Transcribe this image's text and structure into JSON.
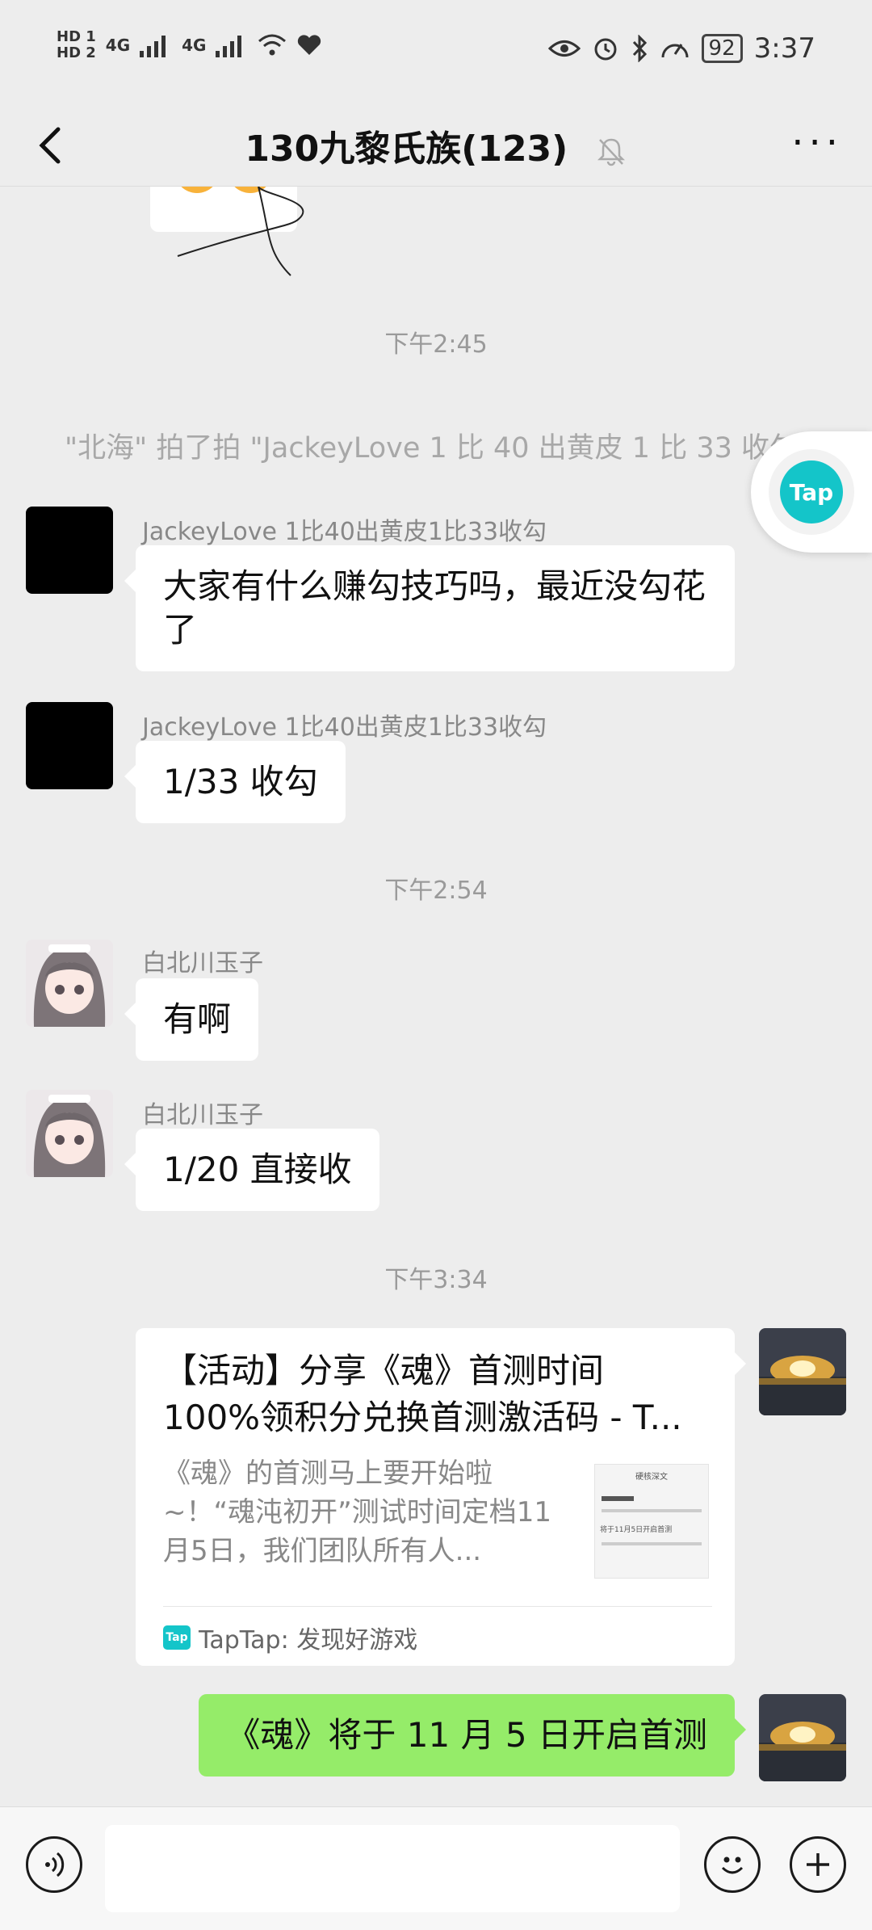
{
  "status_bar": {
    "time": "3:37",
    "battery": "92",
    "network_1": "4G",
    "network_2": "4G",
    "hd_1": "HD 1",
    "hd_2": "HD 2"
  },
  "header": {
    "title": "130九黎氏族(123)",
    "more": "···"
  },
  "messages": {
    "time_1": "下午2:45",
    "pat_text": "\"北海\" 拍了拍 \"JackeyLove 1 比 40 出黄皮 1 比 33 收勾\"",
    "msg1_sender": "JackeyLove 1比40出黄皮1比33收勾",
    "msg1_text": "大家有什么赚勾技巧吗，最近没勾花了",
    "msg2_sender": "JackeyLove 1比40出黄皮1比33收勾",
    "msg2_text": "1/33 收勾",
    "time_2": "下午2:54",
    "msg3_sender": "白北川玉子",
    "msg3_text": "有啊",
    "msg4_sender": "白北川玉子",
    "msg4_text": "1/20 直接收",
    "time_3": "下午3:34",
    "card_title": "【活动】分享《魂》首测时间100%领积分兑换首测激活码 - T...",
    "card_desc": "《魂》的首测马上要开始啦~！“魂沌初开”测试时间定档11月5日，我们团队所有人...",
    "card_source": "TapTap: 发现好游戏",
    "card_thumb_heading": "硬核深文",
    "card_thumb_line": "将于11月5日开启首测",
    "my_text": "《魂》将于 11 月 5 日开启首测"
  },
  "floating": {
    "label": "Tap"
  },
  "colors": {
    "accent_green": "#95ec69",
    "tap_teal": "#14c5c9"
  }
}
